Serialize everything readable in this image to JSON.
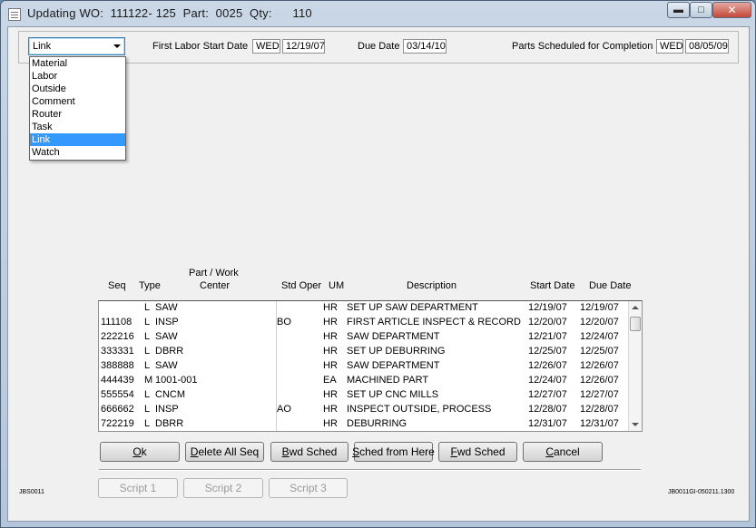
{
  "window": {
    "title": "Updating WO:  111122- 125  Part:  0025  Qty:      110",
    "minimize": "▬",
    "maximize": "□",
    "close": "✕"
  },
  "header": {
    "type_combo_value": "Link",
    "first_labor_label": "First Labor Start Date",
    "first_labor_day": "WED",
    "first_labor_date": "12/19/07",
    "due_label": "Due Date",
    "due_date": "03/14/10",
    "parts_label": "Parts Scheduled for Completion",
    "parts_day": "WED",
    "parts_date": "08/05/09"
  },
  "dropdown_options": [
    "Material",
    "Labor",
    "Outside",
    "Comment",
    "Router",
    "Task",
    "Link",
    "Watch"
  ],
  "grid": {
    "headers": {
      "seq": "Seq",
      "type": "Type",
      "part_wc_1": "Part / Work",
      "part_wc_2": "Center",
      "std_oper": "Std Oper",
      "um": "UM",
      "description": "Description",
      "start": "Start Date",
      "due": "Due Date"
    },
    "rows": [
      {
        "seq": "",
        "type": "L",
        "wc": "SAW",
        "oper": "",
        "um": "HR",
        "desc": "SET UP SAW DEPARTMENT",
        "start": "12/19/07",
        "due": "12/19/07"
      },
      {
        "seq": "111108",
        "type": "L",
        "wc": "INSP",
        "oper": "BO",
        "um": "HR",
        "desc": "FIRST ARTICLE INSPECT & RECORD",
        "start": "12/20/07",
        "due": "12/20/07"
      },
      {
        "seq": "222216",
        "type": "L",
        "wc": "SAW",
        "oper": "",
        "um": "HR",
        "desc": "SAW DEPARTMENT",
        "start": "12/21/07",
        "due": "12/24/07"
      },
      {
        "seq": "333331",
        "type": "L",
        "wc": "DBRR",
        "oper": "",
        "um": "HR",
        "desc": "SET UP DEBURRING",
        "start": "12/25/07",
        "due": "12/25/07"
      },
      {
        "seq": "388888",
        "type": "L",
        "wc": "SAW",
        "oper": "",
        "um": "HR",
        "desc": "SAW DEPARTMENT",
        "start": "12/26/07",
        "due": "12/26/07"
      },
      {
        "seq": "444439",
        "type": "M",
        "wc": "1001-001",
        "oper": "",
        "um": "EA",
        "desc": "MACHINED PART",
        "start": "12/24/07",
        "due": "12/26/07"
      },
      {
        "seq": "555554",
        "type": "L",
        "wc": "CNCM",
        "oper": "",
        "um": "HR",
        "desc": "SET UP CNC MILLS",
        "start": "12/27/07",
        "due": "12/27/07"
      },
      {
        "seq": "666662",
        "type": "L",
        "wc": "INSP",
        "oper": "AO",
        "um": "HR",
        "desc": "INSPECT OUTSIDE, PROCESS",
        "start": "12/28/07",
        "due": "12/28/07"
      },
      {
        "seq": "722219",
        "type": "L",
        "wc": "DBRR",
        "oper": "",
        "um": "HR",
        "desc": "DEBURRING",
        "start": "12/31/07",
        "due": "12/31/07"
      }
    ]
  },
  "buttons": {
    "ok_hot": "O",
    "ok_rest": "k",
    "delete_hot": "D",
    "delete_rest": "elete All Seq",
    "bwd_hot": "B",
    "bwd_rest": "wd Sched",
    "sched_hot": "S",
    "sched_rest": "ched from Here",
    "fwd_hot": "F",
    "fwd_rest": "wd Sched",
    "cancel_hot": "C",
    "cancel_rest": "ancel"
  },
  "scripts": [
    "Script 1",
    "Script 2",
    "Script 3"
  ],
  "footer": {
    "left_code": "JBS0011",
    "right_code": "JB0011GI-050211.1300"
  }
}
